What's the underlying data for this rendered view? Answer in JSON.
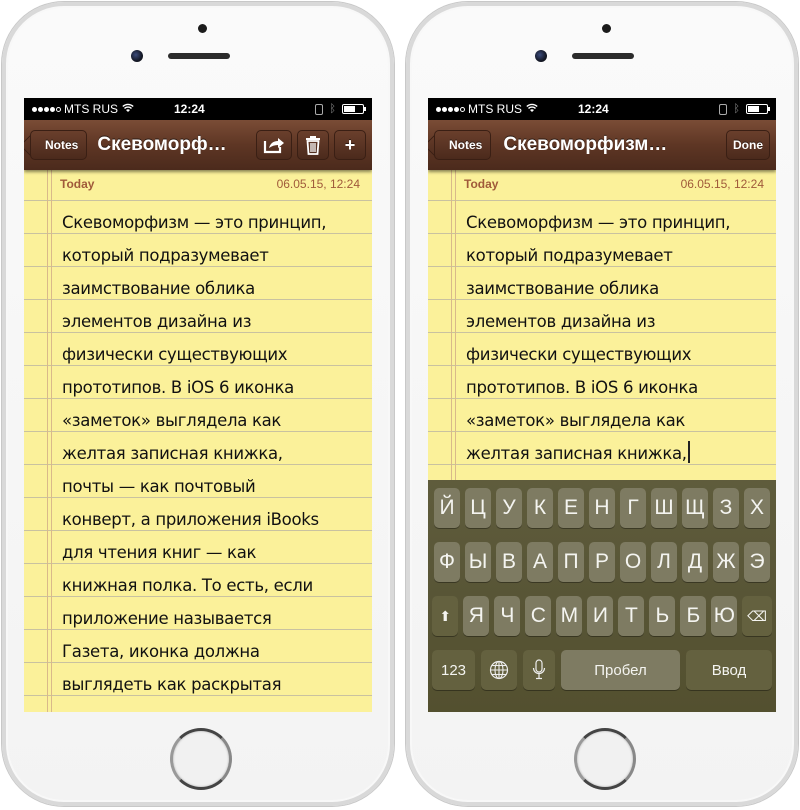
{
  "phones": {
    "left": {
      "status": {
        "carrier": "MTS RUS",
        "time": "12:24",
        "signal_bars": 4,
        "signal_max": 5,
        "wifi_icon": "wifi-icon",
        "bluetooth_icon": "bluetooth-icon",
        "battery_level": 0.6
      },
      "nav": {
        "back_label": "Notes",
        "title": "Скевоморф…",
        "share_icon": "share-icon",
        "trash_icon": "trash-icon",
        "add_label": "+"
      },
      "note": {
        "date_label": "Today",
        "timestamp": "06.05.15, 12:24",
        "lines": [
          "Скевоморфизм — это принцип,",
          "который подразумевает",
          "заимствование облика",
          "элементов дизайна из",
          "физически существующих",
          "прототипов. В iOS 6 иконка",
          "«заметок» выглядела как",
          "желтая записная книжка,",
          "почты — как почтовый",
          "конверт, а приложения iBooks",
          "для чтения книг — как",
          "книжная полка. То есть, если",
          "приложение называется",
          "Газета, иконка должна",
          "выглядеть как раскрытая"
        ]
      }
    },
    "right": {
      "status": {
        "carrier": "MTS RUS",
        "time": "12:24",
        "signal_bars": 4,
        "signal_max": 5,
        "wifi_icon": "wifi-icon",
        "bluetooth_icon": "bluetooth-icon",
        "battery_level": 0.6
      },
      "nav": {
        "back_label": "Notes",
        "title": "Скевоморфизм…",
        "done_label": "Done"
      },
      "note": {
        "date_label": "Today",
        "timestamp": "06.05.15, 12:24",
        "lines": [
          "Скевоморфизм — это принцип,",
          "который подразумевает",
          "заимствование облика",
          "элементов дизайна из",
          "физически существующих",
          "прототипов. В iOS 6 иконка",
          "«заметок» выглядела как",
          "желтая записная книжка,"
        ]
      },
      "keyboard": {
        "row1": [
          "Й",
          "Ц",
          "У",
          "К",
          "Е",
          "Н",
          "Г",
          "Ш",
          "Щ",
          "З",
          "Х"
        ],
        "row2": [
          "Ф",
          "Ы",
          "В",
          "А",
          "П",
          "Р",
          "О",
          "Л",
          "Д",
          "Ж",
          "Э"
        ],
        "row3": [
          "Я",
          "Ч",
          "С",
          "М",
          "И",
          "Т",
          "Ь",
          "Б",
          "Ю"
        ],
        "shift_glyph": "⬆",
        "backspace_glyph": "⌫",
        "numbers_label": "123",
        "globe_glyph": "🌐",
        "mic_glyph": "🎙",
        "space_label": "Пробел",
        "enter_label": "Ввод"
      }
    }
  }
}
